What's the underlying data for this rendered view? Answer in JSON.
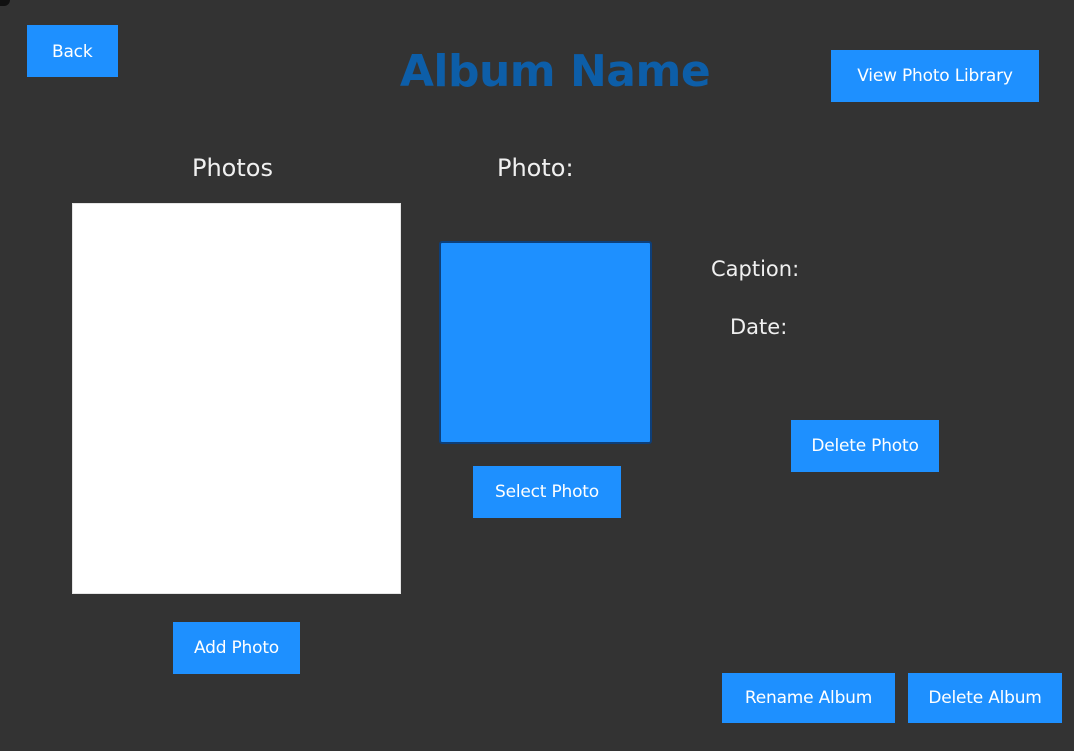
{
  "header": {
    "back_label": "Back",
    "title": "Album Name",
    "view_library_label": "View Photo Library"
  },
  "photos_panel": {
    "heading": "Photos",
    "add_photo_label": "Add Photo"
  },
  "photo_panel": {
    "heading": "Photo:",
    "select_photo_label": "Select Photo"
  },
  "details": {
    "caption_label": "Caption:",
    "date_label": "Date:",
    "delete_photo_label": "Delete Photo"
  },
  "footer": {
    "rename_album_label": "Rename Album",
    "delete_album_label": "Delete Album"
  },
  "colors": {
    "background": "#333333",
    "button": "#1e90ff",
    "title": "#0d5ea8",
    "preview": "#1e90ff"
  }
}
